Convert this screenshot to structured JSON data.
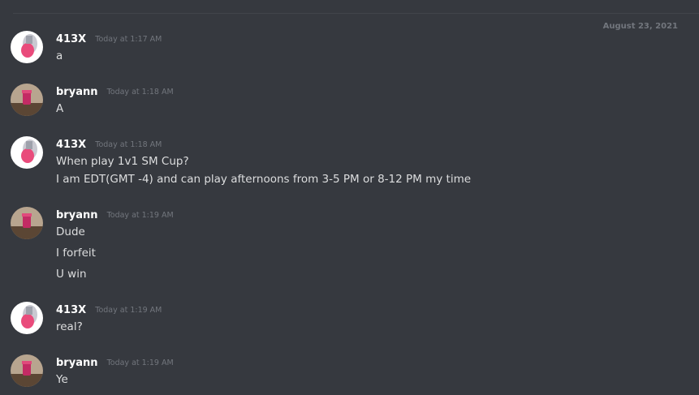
{
  "date_divider": "August 23, 2021",
  "messages": [
    {
      "author": "413X",
      "timestamp": "Today at 1:17 AM",
      "avatar": "cartoon-avatar",
      "lines": [
        "a"
      ]
    },
    {
      "author": "bryann",
      "timestamp": "Today at 1:18 AM",
      "avatar": "photo-avatar",
      "lines": [
        "A"
      ]
    },
    {
      "author": "413X",
      "timestamp": "Today at 1:18 AM",
      "avatar": "cartoon-avatar",
      "lines": [
        "When play 1v1 SM Cup?",
        "I am EDT(GMT -4) and can play afternoons from 3-5 PM or 8-12 PM my time"
      ]
    },
    {
      "author": "bryann",
      "timestamp": "Today at 1:19 AM",
      "avatar": "photo-avatar",
      "lines": [
        "Dude",
        "I forfeit",
        "U win"
      ]
    },
    {
      "author": "413X",
      "timestamp": "Today at 1:19 AM",
      "avatar": "cartoon-avatar",
      "lines": [
        "real?"
      ]
    },
    {
      "author": "bryann",
      "timestamp": "Today at 1:19 AM",
      "avatar": "photo-avatar",
      "lines": [
        "Ye"
      ]
    }
  ]
}
